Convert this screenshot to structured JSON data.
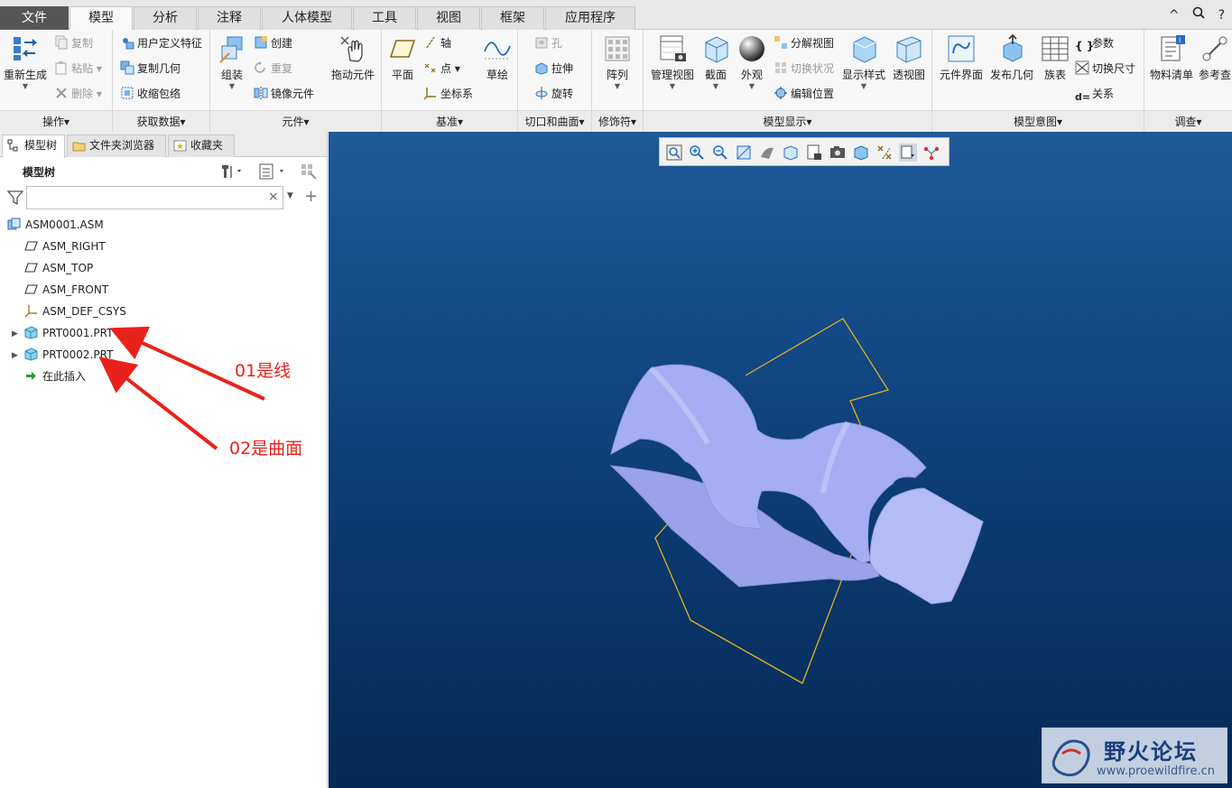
{
  "menu": {
    "tabs": [
      "文件",
      "模型",
      "分析",
      "注释",
      "人体模型",
      "工具",
      "视图",
      "框架",
      "应用程序"
    ],
    "active": "模型"
  },
  "window_icons": [
    "^",
    "?"
  ],
  "ribbon": {
    "operations": {
      "label": "操作▾",
      "regen": "重新生成",
      "copy": "复制",
      "paste": "粘贴",
      "delete": "删除"
    },
    "get_data": {
      "label": "获取数据▾",
      "udf": "用户定义特征",
      "copy_geom": "复制几何",
      "shrinkwrap": "收缩包络"
    },
    "component": {
      "label": "元件▾",
      "assemble": "组装",
      "create": "创建",
      "repeat": "重复",
      "mirror": "镜像元件",
      "drag": "拖动元件"
    },
    "datum": {
      "label": "基准▾",
      "plane": "平面",
      "axis": "轴",
      "point": "点",
      "csys": "坐标系",
      "sketch": "草绘"
    },
    "cut_surface": {
      "label": "切口和曲面▾",
      "hole": "孔",
      "extrude": "拉伸",
      "revolve": "旋转"
    },
    "modifiers": {
      "label": "修饰符▾",
      "pattern": "阵列"
    },
    "display": {
      "label": "模型显示▾",
      "manage_views": "管理视图",
      "section": "截面",
      "appearance": "外观",
      "explode": "分解视图",
      "toggle_status": "切换状况",
      "edit_position": "编辑位置",
      "display_style": "显示样式",
      "perspective": "透视图"
    },
    "intent": {
      "label": "模型意图▾",
      "comp_interface": "元件界面",
      "publish_geom": "发布几何",
      "family_table": "族表",
      "params": "参数",
      "switch_dims": "切换尺寸",
      "relations": "关系"
    },
    "investigate": {
      "label": "调查▾",
      "bom": "物料清单",
      "reference": "参考查看器"
    }
  },
  "panel": {
    "tabs": [
      "模型树",
      "文件夹浏览器",
      "收藏夹"
    ],
    "tree_title": "模型树",
    "search_placeholder": "",
    "clear_label": "×",
    "nodes": [
      "ASM0001.ASM",
      "ASM_RIGHT",
      "ASM_TOP",
      "ASM_FRONT",
      "ASM_DEF_CSYS",
      "PRT0001.PRT",
      "PRT0002.PRT",
      "在此插入"
    ]
  },
  "annotations": {
    "label1": "01是线",
    "label2": "02是曲面"
  },
  "watermark": {
    "title": "野火论坛",
    "url": "www.proewildfire.cn"
  },
  "colors": {
    "viewport_top": "#1f5a99",
    "viewport_bottom": "#052a55",
    "surface": "#9aa3ea",
    "curve": "#e0b020",
    "annotation": "#e8221b"
  }
}
